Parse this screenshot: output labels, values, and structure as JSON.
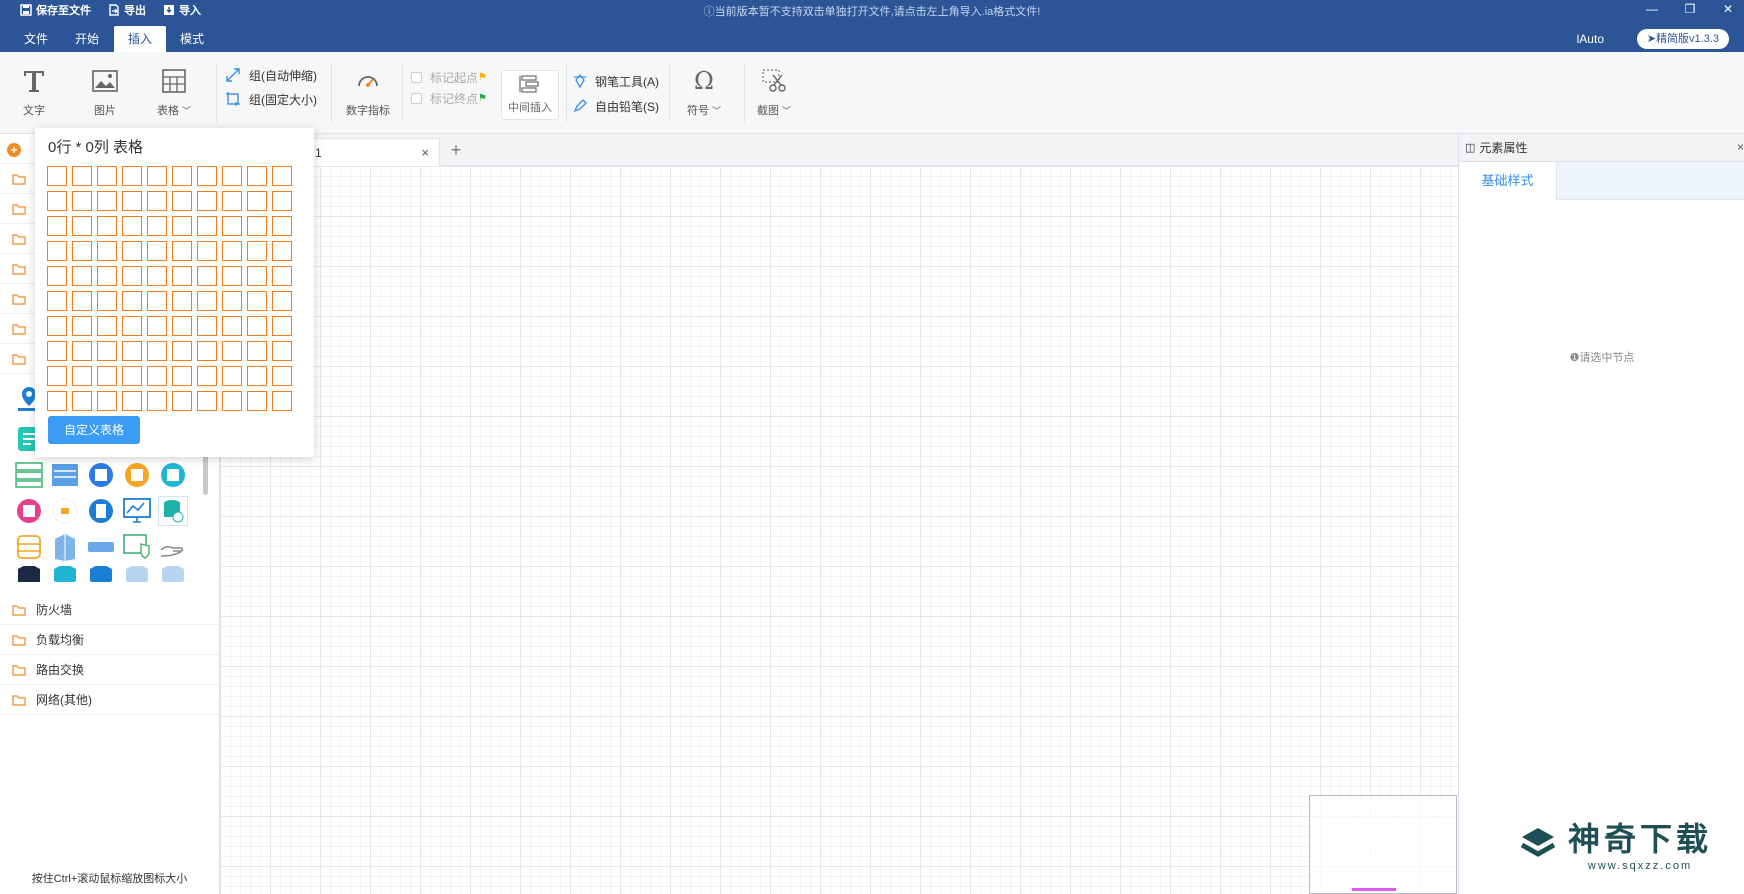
{
  "titlebar": {
    "save_label": "保存至文件",
    "export_label": "导出",
    "import_label": "导入",
    "notice": "当前版本暂不支持双击单独打开文件,请点击左上角导入.ia格式文件!"
  },
  "menu": {
    "tabs": [
      {
        "label": "文件"
      },
      {
        "label": "开始"
      },
      {
        "label": "插入"
      },
      {
        "label": "模式"
      }
    ],
    "active_tab": "插入",
    "user": "lAuto",
    "version": "精简版v1.3.3"
  },
  "ribbon": {
    "text_label": "文字",
    "image_label": "图片",
    "table_label": "表格",
    "group_auto_label": "组(自动伸缩)",
    "group_fixed_label": "组(固定大小)",
    "metric_label": "数字指标",
    "mark_start_label": "标记起点",
    "mark_end_label": "标记终点",
    "mid_insert_label": "中间插入",
    "pen_tool_label": "钢笔工具(A)",
    "pencil_label": "自由铅笔(S)",
    "symbol_label": "符号",
    "screenshot_label": "截图"
  },
  "left_panel": {
    "categories": [
      {
        "label": "防火墙"
      },
      {
        "label": "负载均衡"
      },
      {
        "label": "路由交换"
      },
      {
        "label": "网络(其他)"
      }
    ],
    "status_text": "按住Ctrl+滚动鼠标缩放图标大小"
  },
  "canvas": {
    "tab_label": "1",
    "tab_close": "×",
    "add_tab": "+"
  },
  "right_panel": {
    "title": "元素属性",
    "close": "×",
    "tab_label": "基础样式",
    "empty_text": "请选中节点"
  },
  "table_popup": {
    "title": "0行 * 0列 表格",
    "rows": 10,
    "cols": 10,
    "custom_button": "自定义表格"
  },
  "watermark": {
    "main": "神奇下载",
    "sub": "www.sqxzz.com"
  },
  "colors": {
    "header_bg": "#2b5597",
    "accent_blue": "#3b9cf5",
    "grid_orange": "#f07d1f",
    "folder_orange": "#f08a24"
  }
}
